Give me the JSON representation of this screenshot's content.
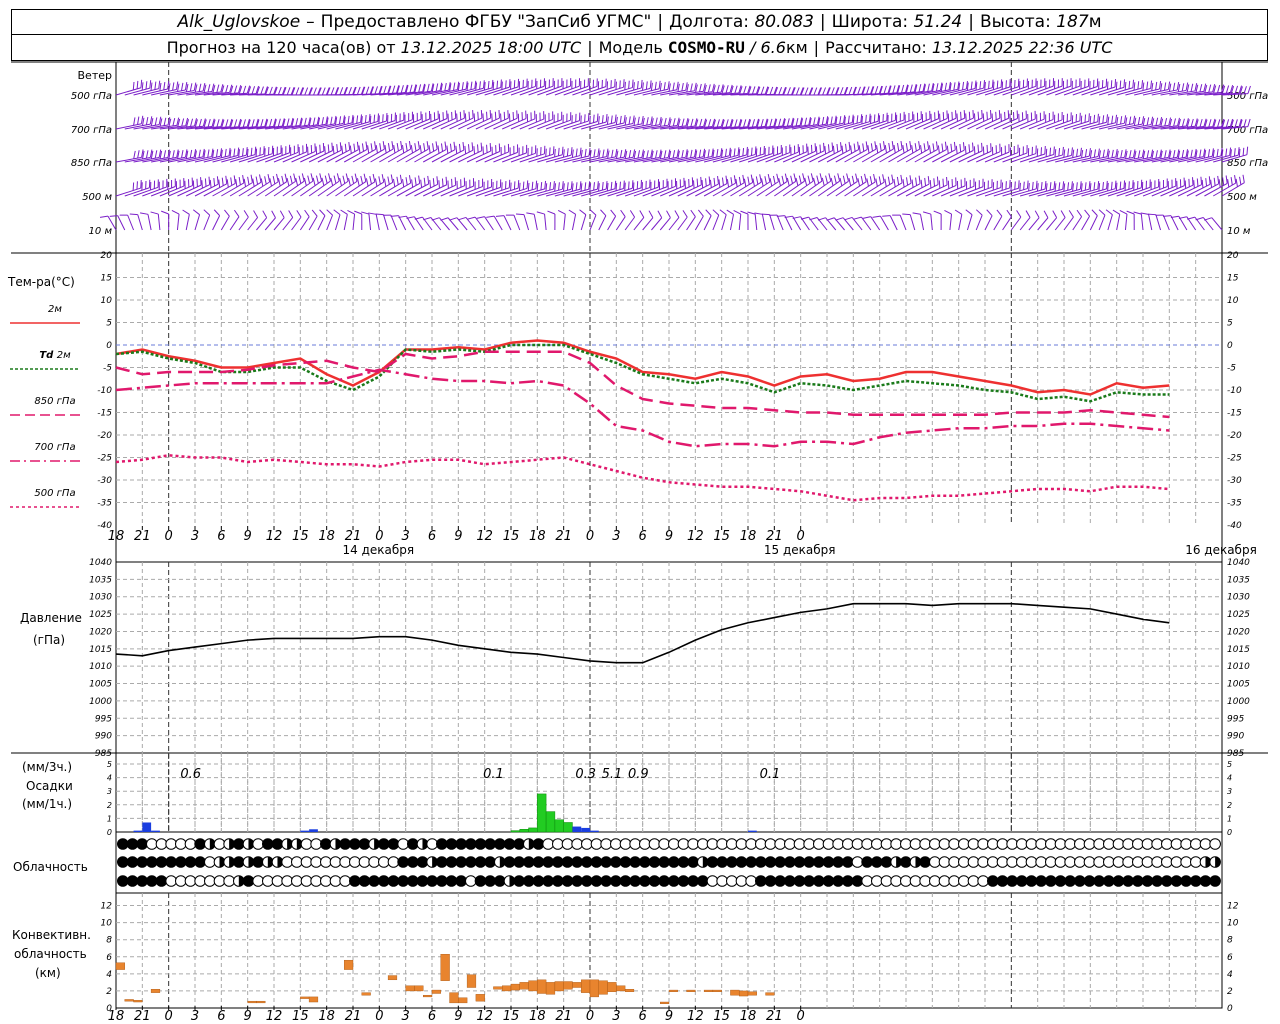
{
  "header": {
    "station": "Alk_Uglovskoe",
    "dash": "–",
    "provider": "Предоставлено ФГБУ \"ЗапСиб УГМС\"",
    "lon_label": "Долгота:",
    "lon": "80.083",
    "lat_label": "Широта:",
    "lat": "51.24",
    "alt_label": "Высота:",
    "alt": "187",
    "alt_unit": "м",
    "forecast_label": "Прогноз на 120 часа(ов) от",
    "forecast_time": "13.12.2025 18:00 UTC",
    "model_label": "Модель",
    "model": "COSMO-RU",
    "resolution": "/ 6.6",
    "res_unit": "км",
    "calc_label": "Рассчитано:",
    "calc_time": "13.12.2025 22:36 UTC"
  },
  "panels": {
    "wind": {
      "title": "Ветер",
      "levels": [
        "500 гПа",
        "700 гПа",
        "850 гПа",
        "500 м",
        "10  м"
      ]
    },
    "temp": {
      "title": "Тем-ра(°C)",
      "legend": [
        {
          "label": "2м",
          "color": "#ee3030",
          "style": "solid"
        },
        {
          "label_italic": "Td",
          "label": "2м",
          "color": "#1a7a1a",
          "style": "dotted"
        },
        {
          "label": "850 гПа",
          "color": "#e0186c",
          "style": "dash"
        },
        {
          "label": "700 гПа",
          "color": "#e0186c",
          "style": "dashdot"
        },
        {
          "label": "500 гПа",
          "color": "#e0186c",
          "style": "dot"
        }
      ]
    },
    "pressure": {
      "title": "Давление",
      "unit": "(гПа)"
    },
    "precip": {
      "unit1": "(мм/3ч.)",
      "title": "Осадки",
      "unit2": "(мм/1ч.)"
    },
    "cloud": {
      "title": "Облачность"
    },
    "conv": {
      "title1": "Конвективн.",
      "title2": "облачность",
      "unit": "(км)"
    }
  },
  "time_axis": {
    "ticks": [
      "18",
      "21",
      "0",
      "3",
      "6",
      "9",
      "12",
      "15",
      "18",
      "21",
      "0",
      "3",
      "6",
      "9",
      "12",
      "15",
      "18",
      "21",
      "0",
      "3",
      "6",
      "9",
      "12",
      "15",
      "18",
      "21",
      "0"
    ],
    "dates": [
      "14 декабря",
      "15 декабря",
      "16 декабря"
    ]
  },
  "chart_data": [
    {
      "type": "line",
      "title": "Тем-ра(°C)",
      "x": [
        -6,
        -3,
        0,
        3,
        6,
        9,
        12,
        15,
        18,
        21,
        24,
        27,
        30,
        33,
        36,
        39,
        42,
        45,
        48,
        51,
        54,
        57,
        60,
        63,
        66,
        69,
        72,
        75,
        78,
        81,
        84,
        87,
        90,
        93,
        96,
        99,
        102,
        105,
        108,
        111,
        114
      ],
      "ylim": [
        -40,
        20
      ],
      "yticks": [
        -40,
        -35,
        -30,
        -25,
        -20,
        -15,
        -10,
        -5,
        0,
        5,
        10,
        15,
        20
      ],
      "series": [
        {
          "name": "2м",
          "color": "#ee3030",
          "values": [
            -2,
            -1,
            -2.5,
            -3.5,
            -5,
            -5,
            -4,
            -3,
            -6.5,
            -9,
            -6,
            -1,
            -1,
            -0.5,
            -1,
            0.5,
            1,
            0.5,
            -1.5,
            -3,
            -6,
            -6.5,
            -7.5,
            -6,
            -7,
            -9,
            -7,
            -6.5,
            -8,
            -7.5,
            -6,
            -6,
            -7,
            -8,
            -9,
            -10.5,
            -10,
            -11,
            -8.5,
            -9.5,
            -9
          ]
        },
        {
          "name": "Td 2м",
          "color": "#1a7a1a",
          "values": [
            -2,
            -1.5,
            -3,
            -4,
            -6,
            -6,
            -5,
            -5,
            -8,
            -10,
            -7,
            -1,
            -1.5,
            -1,
            -1.5,
            0,
            0,
            0,
            -2,
            -4,
            -6.5,
            -7.5,
            -8.5,
            -7.5,
            -8.5,
            -10.5,
            -8.5,
            -9,
            -10,
            -9,
            -8,
            -8.5,
            -9,
            -10,
            -10.5,
            -12,
            -11.5,
            -12.5,
            -10.5,
            -11,
            -11
          ]
        },
        {
          "name": "850 гПа",
          "color": "#e0186c",
          "dash": "14,7",
          "values": [
            -5,
            -6.5,
            -6,
            -6,
            -6,
            -5.5,
            -4.5,
            -4,
            -3.5,
            -5,
            -6,
            -2,
            -3,
            -2.5,
            -1.5,
            -1.5,
            -1.5,
            -1.5,
            -4,
            -9,
            -12,
            -13,
            -13.5,
            -14,
            -14,
            -14.5,
            -15,
            -15,
            -15.5,
            -15.5,
            -15.5,
            -15.5,
            -15.5,
            -15.5,
            -15,
            -15,
            -15,
            -14.5,
            -15,
            -15.5,
            -16
          ]
        },
        {
          "name": "700 гПа",
          "color": "#e0186c",
          "dash": "16,5,3,5",
          "values": [
            -10,
            -9.5,
            -9,
            -8.5,
            -8.5,
            -8.5,
            -8.5,
            -8.5,
            -8.5,
            -7,
            -5.5,
            -6.5,
            -7.5,
            -8,
            -8,
            -8.5,
            -8,
            -9,
            -13,
            -18,
            -19,
            -21.5,
            -22.5,
            -22,
            -22,
            -22.5,
            -21.5,
            -21.5,
            -22,
            -20.5,
            -19.5,
            -19,
            -18.5,
            -18.5,
            -18,
            -18,
            -17.5,
            -17.5,
            -18,
            -18.5,
            -19
          ]
        },
        {
          "name": "500 гПа",
          "color": "#e0186c",
          "dash": "3,3",
          "values": [
            -26,
            -25.5,
            -24.5,
            -25,
            -25,
            -26,
            -25.5,
            -26,
            -26.5,
            -26.5,
            -27,
            -26,
            -25.5,
            -25.5,
            -26.5,
            -26,
            -25.5,
            -25,
            -26.5,
            -28,
            -29.5,
            -30.5,
            -31,
            -31.5,
            -31.5,
            -32,
            -32.5,
            -33.5,
            -34.5,
            -34,
            -34,
            -33.5,
            -33.5,
            -33,
            -32.5,
            -32,
            -32,
            -32.5,
            -31.5,
            -31.5,
            -32
          ]
        }
      ]
    },
    {
      "type": "line",
      "title": "Давление",
      "ylabel": "(гПа)",
      "x": [
        -6,
        -3,
        0,
        3,
        6,
        9,
        12,
        15,
        18,
        21,
        24,
        27,
        30,
        33,
        36,
        39,
        42,
        45,
        48,
        51,
        54,
        57,
        60,
        63,
        66,
        69,
        72,
        75,
        78,
        81,
        84,
        87,
        90,
        93,
        96,
        99,
        102,
        105,
        108,
        111,
        114
      ],
      "ylim": [
        985,
        1040
      ],
      "yticks": [
        985,
        990,
        995,
        1000,
        1005,
        1010,
        1015,
        1020,
        1025,
        1030,
        1035,
        1040
      ],
      "series": [
        {
          "name": "",
          "color": "#000000",
          "values": [
            1013.5,
            1013,
            1014.5,
            1015.5,
            1016.5,
            1017.5,
            1018,
            1018,
            1018,
            1018,
            1018.5,
            1018.5,
            1017.5,
            1016,
            1015,
            1014,
            1013.5,
            1012.5,
            1011.5,
            1011,
            1011,
            1014,
            1017.5,
            1020.5,
            1022.5,
            1024,
            1025.5,
            1026.5,
            1028,
            1028,
            1028,
            1027.5,
            1028,
            1028,
            1028,
            1027.5,
            1027,
            1026.5,
            1025,
            1023.5,
            1022.5
          ]
        }
      ]
    },
    {
      "type": "bar",
      "title": "Осадки",
      "ylim": [
        0,
        5
      ],
      "yticks": [
        0,
        1,
        2,
        3,
        4,
        5
      ],
      "labels3h": [
        {
          "x": 0,
          "text": "0.6"
        },
        {
          "x": 34.5,
          "text": "0.1"
        },
        {
          "x": 45,
          "text": "0.3"
        },
        {
          "x": 48,
          "text": "5.1"
        },
        {
          "x": 51,
          "text": "0.9"
        },
        {
          "x": 66,
          "text": "0.1"
        }
      ],
      "bars": [
        {
          "x": -4,
          "value": 0.1,
          "color": "#1a3ee0"
        },
        {
          "x": -3,
          "value": 0.7,
          "color": "#1a3ee0"
        },
        {
          "x": -2,
          "value": 0.1,
          "color": "#1a3ee0"
        },
        {
          "x": 15,
          "value": 0.1,
          "color": "#1a3ee0"
        },
        {
          "x": 16,
          "value": 0.2,
          "color": "#1a3ee0"
        },
        {
          "x": 39,
          "value": 0.1,
          "color": "#22cc22"
        },
        {
          "x": 40,
          "value": 0.2,
          "color": "#22cc22"
        },
        {
          "x": 41,
          "value": 0.3,
          "color": "#22cc22"
        },
        {
          "x": 42,
          "value": 2.8,
          "color": "#22cc22"
        },
        {
          "x": 43,
          "value": 1.5,
          "color": "#22cc22"
        },
        {
          "x": 44,
          "value": 0.9,
          "color": "#22cc22"
        },
        {
          "x": 45,
          "value": 0.7,
          "color": "#22cc22"
        },
        {
          "x": 46,
          "value": 0.4,
          "color": "#1a3ee0"
        },
        {
          "x": 47,
          "value": 0.3,
          "color": "#1a3ee0"
        },
        {
          "x": 48,
          "value": 0.1,
          "color": "#1a3ee0"
        },
        {
          "x": 66,
          "value": 0.1,
          "color": "#1a3ee0"
        }
      ]
    },
    {
      "type": "table",
      "title": "Облачность",
      "rows": [
        "111000001202123112200121112110123111111111210000000000000000000000000000000000000000000000000000000000000000000000000000001111",
        "111111111022121220000000000001112111111211111111111111111111211111111111111101112121000000000000000000000000000022121",
        "1111100000002100000000001111111111110111211111111111111111111000001111111111100000000000001111111111111111111111111"
      ]
    },
    {
      "type": "bar",
      "title": "Конвективн. облачность",
      "ylabel": "(км)",
      "ylim": [
        0,
        13
      ],
      "yticks": [
        0,
        2,
        4,
        6,
        8,
        10,
        12
      ],
      "color": "#e8842e",
      "bars": [
        {
          "x": -6,
          "bottom": 4.5,
          "top": 5.3
        },
        {
          "x": -5,
          "bottom": 0.8,
          "top": 1.0
        },
        {
          "x": -4,
          "bottom": 0.7,
          "top": 0.9
        },
        {
          "x": -2,
          "bottom": 1.8,
          "top": 2.2
        },
        {
          "x": 9,
          "bottom": 0.6,
          "top": 0.8
        },
        {
          "x": 10,
          "bottom": 0.6,
          "top": 0.8
        },
        {
          "x": 15,
          "bottom": 1.1,
          "top": 1.3
        },
        {
          "x": 16,
          "bottom": 0.7,
          "top": 1.3
        },
        {
          "x": 20,
          "bottom": 4.5,
          "top": 5.6
        },
        {
          "x": 22,
          "bottom": 1.5,
          "top": 1.8
        },
        {
          "x": 25,
          "bottom": 3.3,
          "top": 3.8
        },
        {
          "x": 27,
          "bottom": 2.0,
          "top": 2.6
        },
        {
          "x": 28,
          "bottom": 2.0,
          "top": 2.6
        },
        {
          "x": 29,
          "bottom": 1.3,
          "top": 1.5
        },
        {
          "x": 30,
          "bottom": 1.7,
          "top": 2.1
        },
        {
          "x": 31,
          "bottom": 3.2,
          "top": 6.3
        },
        {
          "x": 32,
          "bottom": 0.6,
          "top": 1.8
        },
        {
          "x": 33,
          "bottom": 0.6,
          "top": 1.2
        },
        {
          "x": 34,
          "bottom": 2.4,
          "top": 3.9
        },
        {
          "x": 35,
          "bottom": 0.8,
          "top": 1.6
        },
        {
          "x": 37,
          "bottom": 2.2,
          "top": 2.5
        },
        {
          "x": 38,
          "bottom": 2.0,
          "top": 2.6
        },
        {
          "x": 39,
          "bottom": 2.1,
          "top": 2.8
        },
        {
          "x": 40,
          "bottom": 2.2,
          "top": 3.0
        },
        {
          "x": 41,
          "bottom": 2.0,
          "top": 3.2
        },
        {
          "x": 42,
          "bottom": 1.7,
          "top": 3.3
        },
        {
          "x": 43,
          "bottom": 1.6,
          "top": 3.0
        },
        {
          "x": 44,
          "bottom": 2.0,
          "top": 3.1
        },
        {
          "x": 45,
          "bottom": 2.2,
          "top": 3.1
        },
        {
          "x": 46,
          "bottom": 2.4,
          "top": 3.0
        },
        {
          "x": 47,
          "bottom": 1.8,
          "top": 3.3
        },
        {
          "x": 48,
          "bottom": 1.3,
          "top": 3.3
        },
        {
          "x": 49,
          "bottom": 1.6,
          "top": 3.2
        },
        {
          "x": 50,
          "bottom": 1.9,
          "top": 3.0
        },
        {
          "x": 51,
          "bottom": 2.0,
          "top": 2.6
        },
        {
          "x": 52,
          "bottom": 1.9,
          "top": 2.2
        },
        {
          "x": 56,
          "bottom": 0.5,
          "top": 0.7
        },
        {
          "x": 57,
          "bottom": 1.9,
          "top": 2.1
        },
        {
          "x": 59,
          "bottom": 1.9,
          "top": 2.1
        },
        {
          "x": 61,
          "bottom": 1.9,
          "top": 2.1
        },
        {
          "x": 62,
          "bottom": 1.9,
          "top": 2.1
        },
        {
          "x": 64,
          "bottom": 1.5,
          "top": 2.1
        },
        {
          "x": 65,
          "bottom": 1.4,
          "top": 2.0
        },
        {
          "x": 66,
          "bottom": 1.5,
          "top": 1.9
        },
        {
          "x": 68,
          "bottom": 1.5,
          "top": 1.8
        }
      ]
    }
  ]
}
